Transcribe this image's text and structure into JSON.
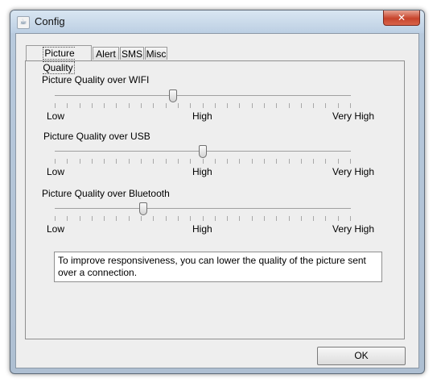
{
  "window": {
    "title": "Config",
    "close_glyph": "✕"
  },
  "tabs": [
    {
      "label": "Picture Quality",
      "active": true
    },
    {
      "label": "Alert"
    },
    {
      "label": "SMS"
    },
    {
      "label": "Misc"
    }
  ],
  "sliders": [
    {
      "label": "Picture Quality over WIFI",
      "value_fraction": 0.4,
      "ticks": [
        "Low",
        "High",
        "Very High"
      ]
    },
    {
      "label": "Picture Quality over USB",
      "value_fraction": 0.5,
      "ticks": [
        "Low",
        "High",
        "Very High"
      ]
    },
    {
      "label": "Picture Quality over Bluetooth",
      "value_fraction": 0.3,
      "ticks": [
        "Low",
        "High",
        "Very High"
      ]
    }
  ],
  "info_text": "To improve responsiveness, you can lower the quality of the picture sent over a connection.",
  "ok_label": "OK",
  "icons": {
    "app": "java-cup-icon",
    "close": "close-icon"
  },
  "colors": {
    "titlebar": "#c9d8e8",
    "close_button": "#c7442c",
    "panel": "#eeeeee"
  }
}
